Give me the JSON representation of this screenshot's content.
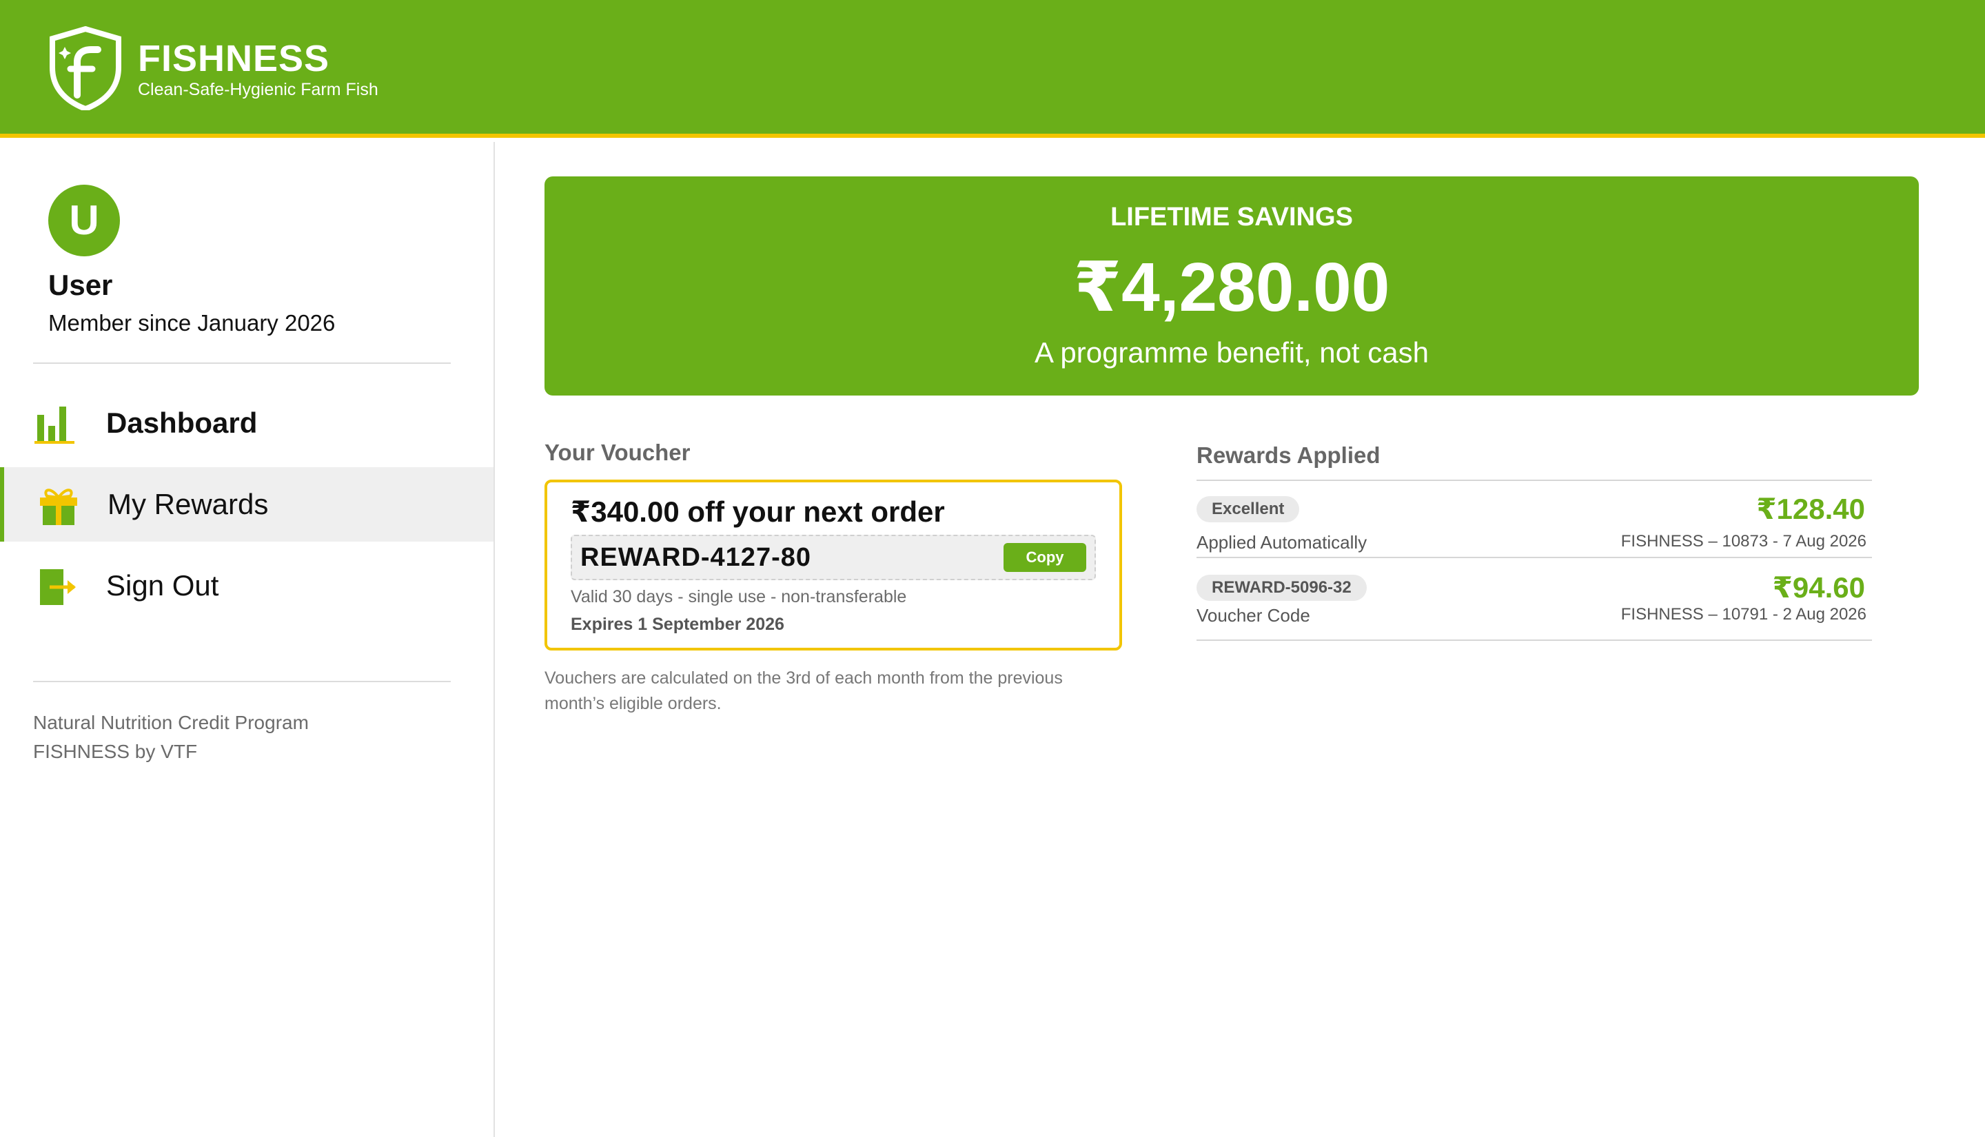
{
  "header": {
    "brand": "FISHNESS",
    "tagline": "Clean-Safe-Hygienic Farm Fish",
    "logo_letter": "F"
  },
  "colors": {
    "brand_green": "#6aaf19",
    "accent_yellow": "#f2c500"
  },
  "profile": {
    "avatar_initial": "U",
    "name": "User",
    "member_since": "Member since January 2026"
  },
  "nav": {
    "items": [
      {
        "label": "Dashboard",
        "icon": "bar-chart-icon",
        "active": false
      },
      {
        "label": "My Rewards",
        "icon": "gift-icon",
        "active": true
      },
      {
        "label": "Sign Out",
        "icon": "sign-out-icon",
        "active": false
      }
    ]
  },
  "sidebar_footer": {
    "line1": "Natural Nutrition Credit Program",
    "line2": "FISHNESS by VTF"
  },
  "savings": {
    "title": "LIFETIME SAVINGS",
    "amount": "₹4,280.00",
    "note": "A programme benefit, not cash"
  },
  "voucher": {
    "section_title": "Your Voucher",
    "headline": "₹340.00 off your next order",
    "code": "REWARD-4127-80",
    "copy_label": "Copy",
    "validity": "Valid 30 days - single use - non-transferable",
    "expires": "Expires 1 September 2026",
    "note": "Vouchers are calculated on the 3rd of each month from the previous month’s eligible orders."
  },
  "rewards": {
    "section_title": "Rewards Applied",
    "items": [
      {
        "badge": "Excellent",
        "method": "Applied Automatically",
        "amount": "₹128.40",
        "order": "FISHNESS – 10873 - 7 Aug 2026"
      },
      {
        "badge": "REWARD-5096-32",
        "method": "Voucher Code",
        "amount": "₹94.60",
        "order": "FISHNESS – 10791 - 2 Aug 2026"
      }
    ]
  }
}
